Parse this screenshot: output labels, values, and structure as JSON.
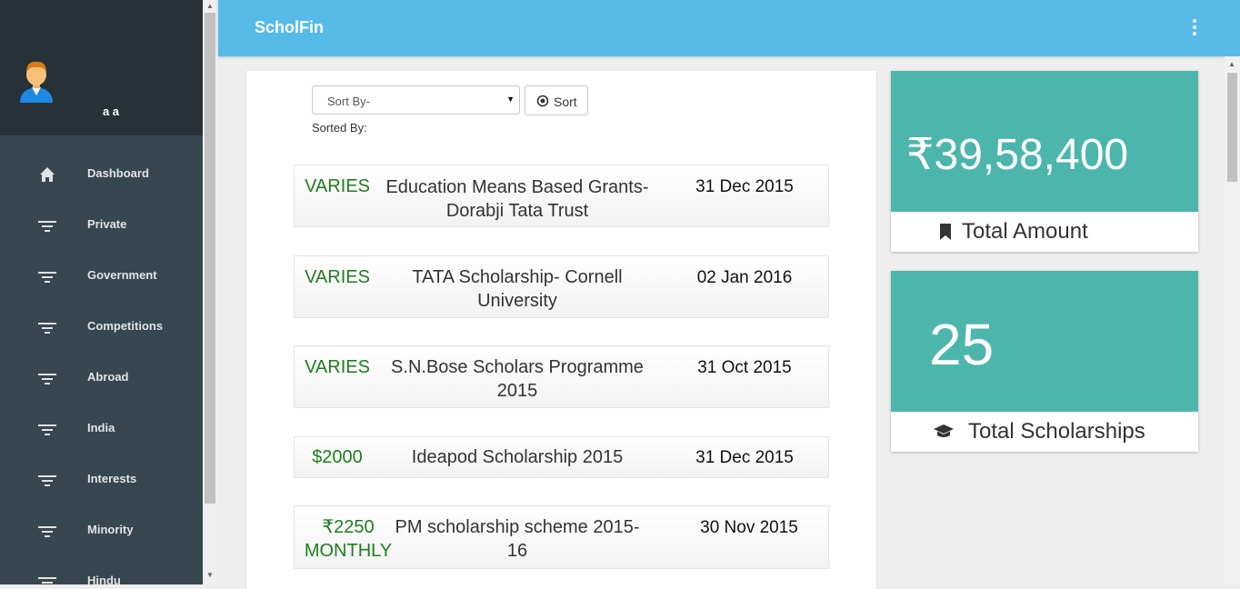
{
  "app": {
    "title": "ScholFin"
  },
  "user": {
    "name": "a a"
  },
  "sidebar": {
    "items": [
      {
        "label": "Dashboard",
        "icon": "home-icon"
      },
      {
        "label": "Private",
        "icon": "filter-icon"
      },
      {
        "label": "Government",
        "icon": "filter-icon"
      },
      {
        "label": "Competitions",
        "icon": "filter-icon"
      },
      {
        "label": "Abroad",
        "icon": "filter-icon"
      },
      {
        "label": "India",
        "icon": "filter-icon"
      },
      {
        "label": "Interests",
        "icon": "filter-icon"
      },
      {
        "label": "Minority",
        "icon": "filter-icon"
      },
      {
        "label": "Hindu",
        "icon": "filter-icon"
      }
    ]
  },
  "sort": {
    "placeholder": "Sort By-",
    "button_label": "Sort",
    "sorted_by_label": "Sorted By:"
  },
  "scholarships": [
    {
      "amount": "VARIES",
      "name": "Education Means Based Grants- Dorabji Tata Trust",
      "date": "31 Dec 2015"
    },
    {
      "amount": "VARIES",
      "name": "TATA Scholarship- Cornell University",
      "date": "02 Jan 2016"
    },
    {
      "amount": "VARIES",
      "name": "S.N.Bose Scholars Programme 2015",
      "date": "31 Oct 2015"
    },
    {
      "amount": "$2000",
      "name": "Ideapod Scholarship 2015",
      "date": "31 Dec 2015"
    },
    {
      "amount": "₹2250 MONTHLY",
      "name": "PM scholarship scheme 2015-16",
      "date": "30 Nov 2015"
    }
  ],
  "stats": {
    "total_amount": {
      "value": "₹39,58,400",
      "label": "Total Amount",
      "icon": "bookmark-icon"
    },
    "total_scholarships": {
      "value": "25",
      "label": "Total Scholarships",
      "icon": "graduation-cap-icon"
    }
  },
  "colors": {
    "topbar": "#56bbe9",
    "sidebar": "#37474f",
    "profile_bg": "#263238",
    "stat_card": "#4db6ac",
    "amount_text": "#1e7e1e"
  }
}
